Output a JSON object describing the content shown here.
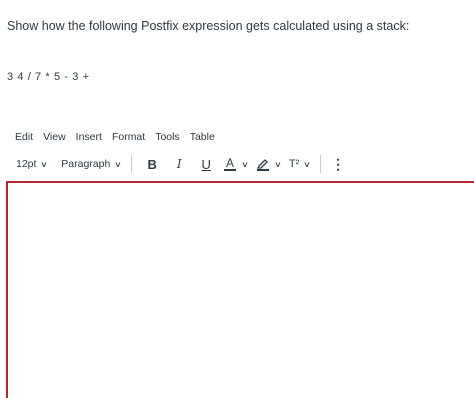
{
  "question": {
    "text": "Show how the following Postfix expression gets calculated using a stack:"
  },
  "expression": {
    "text": "3 4 / 7 * 5 - 3 +"
  },
  "menubar": {
    "edit": "Edit",
    "view": "View",
    "insert": "Insert",
    "format": "Format",
    "tools": "Tools",
    "table": "Table"
  },
  "toolbar": {
    "font_size": "12pt",
    "block_format": "Paragraph",
    "bold": "B",
    "italic": "I",
    "underline": "U",
    "text_color": "A",
    "superscript": "T²",
    "more": "⋮"
  },
  "colors": {
    "text": "#2d3b45",
    "editor_border": "#b9232c",
    "text_color_swatch": "#2d3b45",
    "highlight_swatch": "#2d3b45"
  },
  "editor": {
    "content": ""
  }
}
